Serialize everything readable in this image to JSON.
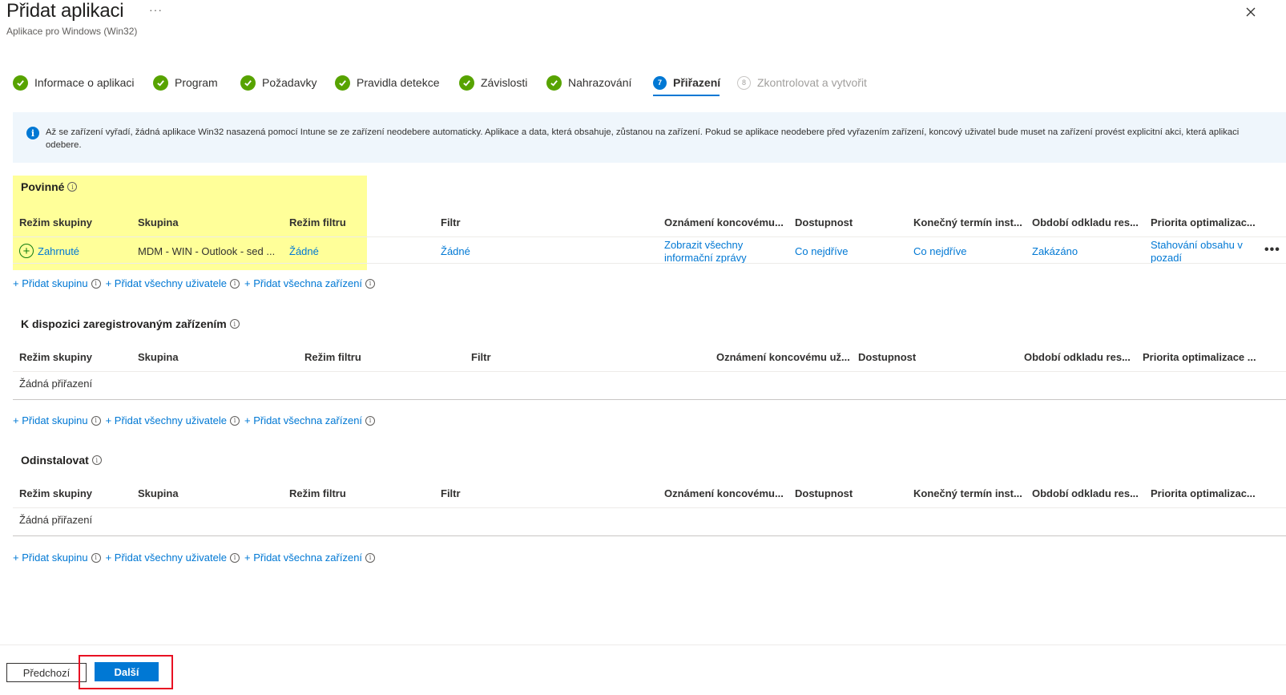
{
  "header": {
    "title": "Přidat aplikaci",
    "more": "···",
    "subtitle": "Aplikace pro Windows (Win32)"
  },
  "steps": [
    {
      "label": "Informace o aplikaci",
      "state": "done"
    },
    {
      "label": "Program",
      "state": "done"
    },
    {
      "label": "Požadavky",
      "state": "done"
    },
    {
      "label": "Pravidla detekce",
      "state": "done"
    },
    {
      "label": "Závislosti",
      "state": "done"
    },
    {
      "label": "Nahrazování",
      "state": "done"
    },
    {
      "label": "Přiřazení",
      "state": "active",
      "number": "7"
    },
    {
      "label": "Zkontrolovat a vytvořit",
      "state": "disabled",
      "number": "8"
    }
  ],
  "info_banner": "Až se zařízení vyřadí, žádná aplikace Win32 nasazená pomocí Intune se ze zařízení neodebere automaticky. Aplikace a data, která obsahuje, zůstanou na zařízení. Pokud se aplikace neodebere před vyřazením zařízení, koncový uživatel bude muset na zařízení provést explicitní akci, která aplikaci odebere.",
  "add_links": {
    "group": "+ Přidat skupinu",
    "all_users": "+ Přidat všechny uživatele",
    "all_devices": "+ Přidat všechna zařízení"
  },
  "required": {
    "title": "Povinné",
    "columns": [
      "Režim skupiny",
      "Skupina",
      "Režim filtru",
      "Filtr",
      "Oznámení koncovému...",
      "Dostupnost",
      "Konečný termín inst...",
      "Období odkladu res...",
      "Priorita optimalizac..."
    ],
    "row": {
      "group_mode": "Zahrnuté",
      "group": "MDM - WIN - Outlook - sed ...",
      "filter_mode": "Žádné",
      "filter": "Žádné",
      "notifications": "Zobrazit všechny informační zprávy",
      "availability": "Co nejdříve",
      "deadline": "Co nejdříve",
      "grace_period": "Zakázáno",
      "priority": "Stahování obsahu v pozadí",
      "more": "•••"
    }
  },
  "available": {
    "title": "K dispozici zaregistrovaným zařízením",
    "columns": [
      "Režim skupiny",
      "Skupina",
      "Režim filtru",
      "Filtr",
      "Oznámení koncovému už...",
      "Dostupnost",
      "Období odkladu res...",
      "Priorita optimalizace ..."
    ],
    "empty": "Žádná přiřazení"
  },
  "uninstall": {
    "title": "Odinstalovat",
    "columns": [
      "Režim skupiny",
      "Skupina",
      "Režim filtru",
      "Filtr",
      "Oznámení koncovému...",
      "Dostupnost",
      "Konečný termín inst...",
      "Období odkladu res...",
      "Priorita optimalizac..."
    ],
    "empty": "Žádná přiřazení"
  },
  "footer": {
    "prev": "Předchozí",
    "next": "Další"
  },
  "colors": {
    "accent": "#0078d4",
    "success": "#57a300",
    "highlight": "#ffff99",
    "annotation": "#e81123"
  }
}
